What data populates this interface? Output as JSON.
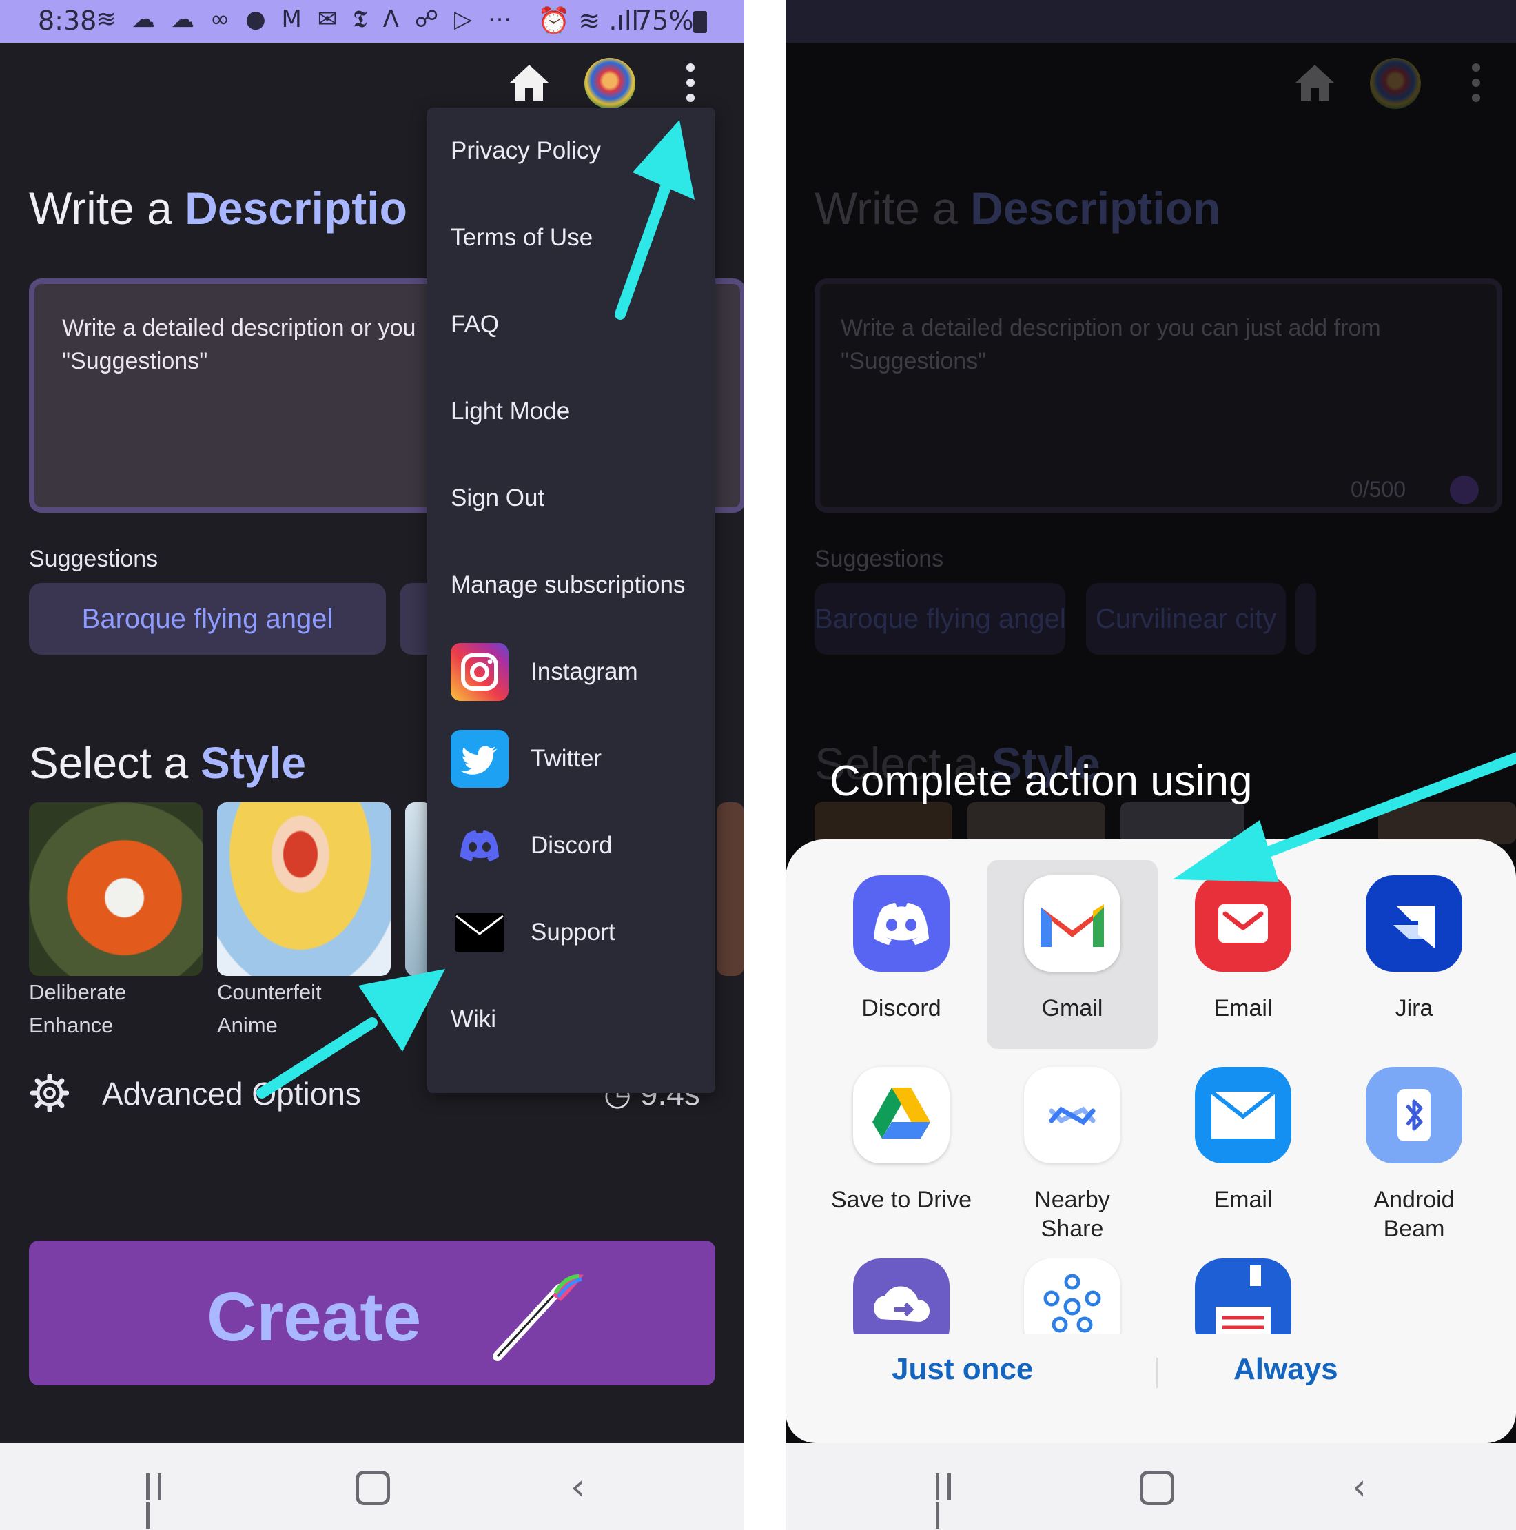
{
  "status_bar": {
    "time": "8:38",
    "notification_icons": "≋ ☁ ☁ ∞ ● M ✉ 𝕿 Λ ☍ ▷ ⋯",
    "alarm_signal": "⏰ ≋ .ıll",
    "battery": "75%"
  },
  "header": {
    "home_icon": "home-icon",
    "avatar": "user-avatar",
    "menu_icon": "more-vert-icon"
  },
  "page": {
    "title_prefix": "Write a ",
    "title_highlight_left": "Descriptio",
    "title_highlight_right": "Description",
    "placeholder_left": "Write a detailed description or you\n\"Suggestions\"",
    "placeholder_right": "Write a detailed description or you can just add from\n\"Suggestions\"",
    "char_counter": "0/500",
    "suggestions_label": "Suggestions",
    "suggestions": [
      "Baroque flying angel",
      "Curvilinear city"
    ],
    "style_prefix": "Select a ",
    "style_highlight": "Style",
    "styles": [
      {
        "line1": "Deliberate",
        "line2": "Enhance"
      },
      {
        "line1": "Counterfeit",
        "line2": "Anime"
      }
    ],
    "advanced_label": "Advanced Options",
    "timer": "9.4s",
    "create_label": "Create"
  },
  "menu": {
    "items": [
      "Privacy Policy",
      "Terms of Use",
      "FAQ",
      "Light Mode",
      "Sign Out",
      "Manage subscriptions",
      "Instagram",
      "Twitter",
      "Discord",
      "Support",
      "Wiki"
    ]
  },
  "share_sheet": {
    "title": "Complete action using",
    "apps": [
      {
        "label": "Discord"
      },
      {
        "label": "Gmail"
      },
      {
        "label": "Email"
      },
      {
        "label": "Jira"
      },
      {
        "label": "Save to Drive"
      },
      {
        "label": "Nearby\nShare"
      },
      {
        "label": "Email"
      },
      {
        "label": "Android\nBeam"
      }
    ],
    "just_once": "Just once",
    "always": "Always"
  },
  "colors": {
    "accent_purple": "#7a3ea6",
    "highlight_blue": "#a8b7ff",
    "annotation_arrow": "#2ee8e8",
    "action_blue": "#1465c0"
  }
}
